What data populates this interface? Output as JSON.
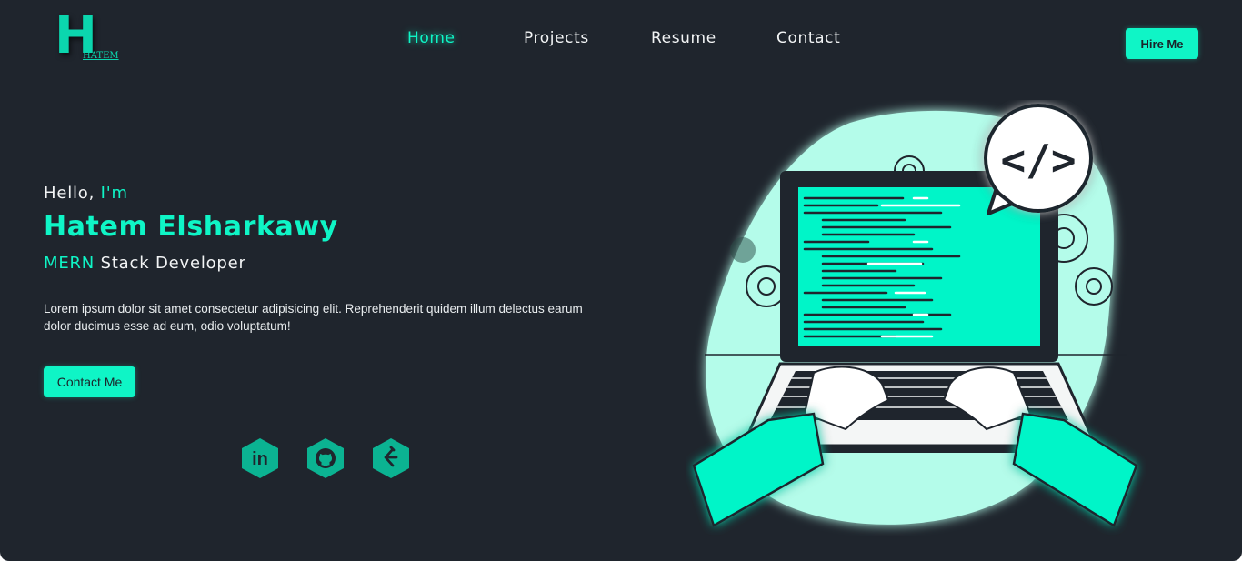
{
  "logo": {
    "letter": "H",
    "sub": "HATEM"
  },
  "nav": {
    "items": [
      {
        "label": "Home",
        "active": true
      },
      {
        "label": "Projects",
        "active": false
      },
      {
        "label": "Resume",
        "active": false
      },
      {
        "label": "Contact",
        "active": false
      }
    ],
    "hire_label": "Hire Me"
  },
  "hero": {
    "greeting": "Hello, ",
    "greeting_accent": "I'm",
    "name": "Hatem Elsharkawy",
    "role_accent": "MERN",
    "role_rest": " Stack Developer",
    "description": "Lorem ipsum dolor sit amet consectetur adipisicing elit. Reprehenderit quidem illum delectus earum dolor ducimus esse ad eum, odio voluptatum!",
    "cta_label": "Contact Me"
  },
  "socials": [
    {
      "icon": "linkedin-icon",
      "text": "in"
    },
    {
      "icon": "github-icon"
    },
    {
      "icon": "leetcode-icon"
    }
  ],
  "illustration": {
    "bubble_text": "</>"
  },
  "colors": {
    "background": "#1f252d",
    "accent": "#0ff5c6",
    "accent_dark": "#0bb392",
    "blob": "#b4fcea",
    "text": "#f2f4f5"
  }
}
